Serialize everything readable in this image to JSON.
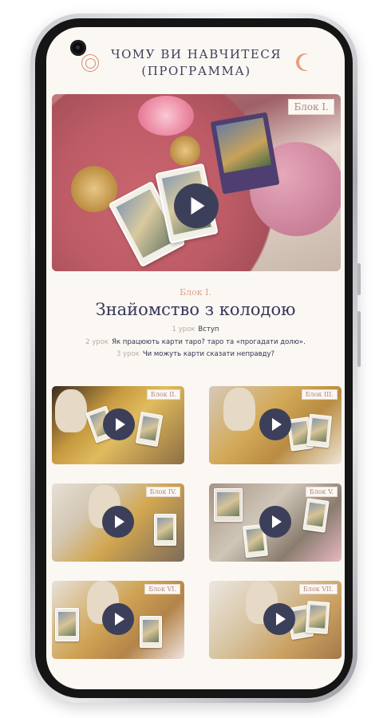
{
  "header": {
    "title": "ЧОМУ ВИ НАВЧИТЕСЯ (ПРОГРАММА)"
  },
  "hero": {
    "badge": "Блок I."
  },
  "block": {
    "label": "Блок I.",
    "title": "Знайомство з колодою",
    "lessons": [
      {
        "num": "1 урок",
        "text": "Вступ"
      },
      {
        "num": "2 урок",
        "text": "Як працюють карти таро? таро та «прогадати долю»."
      },
      {
        "num": "3 урок",
        "text": "Чи можуть карти сказати неправду?"
      }
    ]
  },
  "thumbnails": [
    {
      "badge": "Блок II."
    },
    {
      "badge": "Блок III."
    },
    {
      "badge": "Блок IV."
    },
    {
      "badge": "Блок V."
    },
    {
      "badge": "Блок VI."
    },
    {
      "badge": "Блок VII."
    }
  ],
  "colors": {
    "accent": "#dba28c",
    "title": "#3e3d5a",
    "play_button": "#3c3f59",
    "background": "#fbf8f3"
  }
}
